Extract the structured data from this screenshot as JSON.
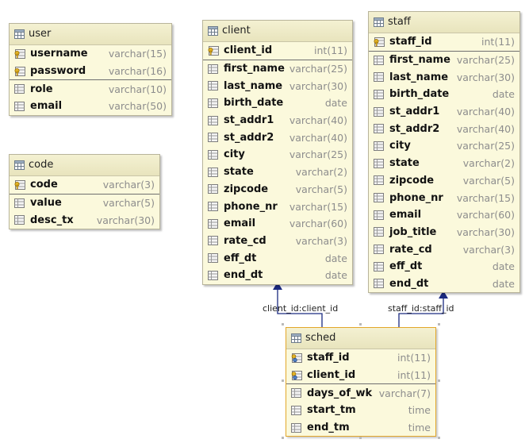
{
  "entities": {
    "user": {
      "title": "user",
      "pk": [
        {
          "name": "username",
          "type": "varchar(15)"
        },
        {
          "name": "password",
          "type": "varchar(16)"
        }
      ],
      "cols": [
        {
          "name": "role",
          "type": "varchar(10)"
        },
        {
          "name": "email",
          "type": "varchar(50)"
        }
      ]
    },
    "code": {
      "title": "code",
      "pk": [
        {
          "name": "code",
          "type": "varchar(3)"
        }
      ],
      "cols": [
        {
          "name": "value",
          "type": "varchar(5)"
        },
        {
          "name": "desc_tx",
          "type": "varchar(30)"
        }
      ]
    },
    "client": {
      "title": "client",
      "pk": [
        {
          "name": "client_id",
          "type": "int(11)"
        }
      ],
      "cols": [
        {
          "name": "first_name",
          "type": "varchar(25)"
        },
        {
          "name": "last_name",
          "type": "varchar(30)"
        },
        {
          "name": "birth_date",
          "type": "date"
        },
        {
          "name": "st_addr1",
          "type": "varchar(40)"
        },
        {
          "name": "st_addr2",
          "type": "varchar(40)"
        },
        {
          "name": "city",
          "type": "varchar(25)"
        },
        {
          "name": "state",
          "type": "varchar(2)"
        },
        {
          "name": "zipcode",
          "type": "varchar(5)"
        },
        {
          "name": "phone_nr",
          "type": "varchar(15)"
        },
        {
          "name": "email",
          "type": "varchar(60)"
        },
        {
          "name": "rate_cd",
          "type": "varchar(3)"
        },
        {
          "name": "eff_dt",
          "type": "date"
        },
        {
          "name": "end_dt",
          "type": "date"
        }
      ]
    },
    "staff": {
      "title": "staff",
      "pk": [
        {
          "name": "staff_id",
          "type": "int(11)"
        }
      ],
      "cols": [
        {
          "name": "first_name",
          "type": "varchar(25)"
        },
        {
          "name": "last_name",
          "type": "varchar(30)"
        },
        {
          "name": "birth_date",
          "type": "date"
        },
        {
          "name": "st_addr1",
          "type": "varchar(40)"
        },
        {
          "name": "st_addr2",
          "type": "varchar(40)"
        },
        {
          "name": "city",
          "type": "varchar(25)"
        },
        {
          "name": "state",
          "type": "varchar(2)"
        },
        {
          "name": "zipcode",
          "type": "varchar(5)"
        },
        {
          "name": "phone_nr",
          "type": "varchar(15)"
        },
        {
          "name": "email",
          "type": "varchar(60)"
        },
        {
          "name": "job_title",
          "type": "varchar(30)"
        },
        {
          "name": "rate_cd",
          "type": "varchar(3)"
        },
        {
          "name": "eff_dt",
          "type": "date"
        },
        {
          "name": "end_dt",
          "type": "date"
        }
      ]
    },
    "sched": {
      "title": "sched",
      "pk": [
        {
          "name": "staff_id",
          "type": "int(11)",
          "fk": true
        },
        {
          "name": "client_id",
          "type": "int(11)",
          "fk": true
        }
      ],
      "cols": [
        {
          "name": "days_of_wk",
          "type": "varchar(7)"
        },
        {
          "name": "start_tm",
          "type": "time"
        },
        {
          "name": "end_tm",
          "type": "time"
        }
      ]
    }
  },
  "relations": {
    "client_label": "client_id:client_id",
    "staff_label": "staff_id:staff_id"
  },
  "colors": {
    "connector": "#1a2a80",
    "entity_bg": "#fbf9dc",
    "selected_border": "#e3a72a"
  }
}
